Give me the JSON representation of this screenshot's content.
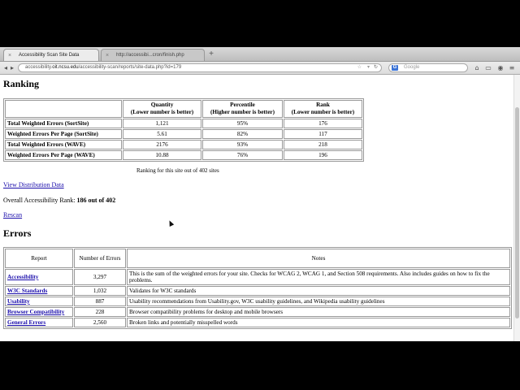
{
  "browser": {
    "tabs": [
      {
        "title": "Accessibility Scan Site Data",
        "close": "×"
      },
      {
        "title": "http://accessibi...cron/finish.php",
        "close": "×"
      }
    ],
    "new_tab": "+",
    "url_prefix": "accessibility.",
    "url_host": "oit.ncsu.edu",
    "url_path": "/accessibility-scan/reports/site-data.php?id=179",
    "search_engine_badge": "G",
    "search_placeholder": "Google",
    "icons": {
      "back": "back-arrow-icon",
      "forward": "forward-arrow-icon",
      "reload": "reload-icon",
      "home": "home-icon",
      "bookmark": "star-icon"
    }
  },
  "ranking": {
    "heading": "Ranking",
    "headers": {
      "quantity": "Quantity",
      "quantity_sub": "(Lower number is better)",
      "percentile": "Percentile",
      "percentile_sub": "(Higher number is better)",
      "rank": "Rank",
      "rank_sub": "(Lower number is better)"
    },
    "rows": [
      {
        "label": "Total Weighted Errors (SortSite)",
        "quantity": "1,121",
        "percentile": "95%",
        "rank": "176"
      },
      {
        "label": "Weighted Errors Per Page (SortSite)",
        "quantity": "5.61",
        "percentile": "82%",
        "rank": "117"
      },
      {
        "label": "Total Weighted Errors (WAVE)",
        "quantity": "2176",
        "percentile": "93%",
        "rank": "218"
      },
      {
        "label": "Weighted Errors Per Page (WAVE)",
        "quantity": "10.88",
        "percentile": "76%",
        "rank": "196"
      }
    ],
    "caption": "Ranking for this site out of 402 sites",
    "view_distribution": "View Distribution Data",
    "overall_label": "Overall Accessibility Rank: ",
    "overall_value": "186 out of 402",
    "rescan": "Rescan"
  },
  "errors": {
    "heading": "Errors",
    "headers": {
      "report": "Report",
      "number": "Number of Errors",
      "notes": "Notes"
    },
    "rows": [
      {
        "report": "Accessibility",
        "count": "3,297",
        "notes": "This is the sum of the weighted errors for your site. Checks for WCAG 2, WCAG 1, and Section 508 requirements. Also includes guides on how to fix the problems."
      },
      {
        "report": "W3C Standards",
        "count": "1,032",
        "notes": "Validates for W3C standards"
      },
      {
        "report": "Usability",
        "count": "887",
        "notes": "Usability recommendations from Usability.gov, W3C usability guidelines, and Wikipedia usability guidelines"
      },
      {
        "report": "Browser Compatibility",
        "count": "228",
        "notes": "Browser compatibility problems for desktop and mobile browsers"
      },
      {
        "report": "General Errors",
        "count": "2,560",
        "notes": "Broken links and potentially misspelled words"
      }
    ]
  }
}
